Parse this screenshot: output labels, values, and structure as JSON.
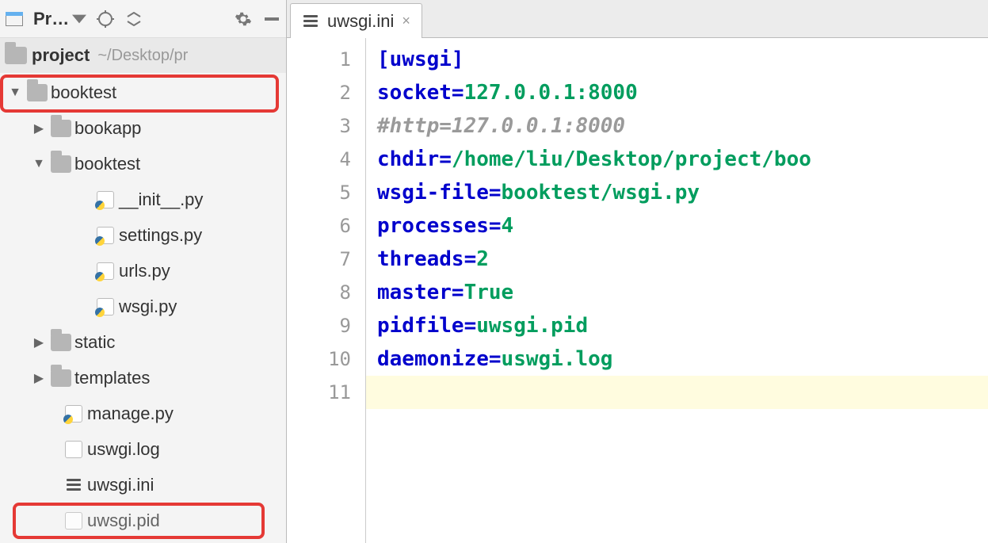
{
  "sidebar": {
    "toolbar_label": "Pr…",
    "root_name": "project",
    "root_path": "~/Desktop/pr",
    "tree": {
      "booktest": "booktest",
      "bookapp": "bookapp",
      "booktest_inner": "booktest",
      "init_py": "__init__.py",
      "settings_py": "settings.py",
      "urls_py": "urls.py",
      "wsgi_py": "wsgi.py",
      "static": "static",
      "templates": "templates",
      "manage_py": "manage.py",
      "uswgi_log": "uswgi.log",
      "uwsgi_ini": "uwsgi.ini",
      "uwsgi_pid": "uwsgi.pid"
    }
  },
  "tabs": {
    "active": "uwsgi.ini"
  },
  "gutter": [
    "1",
    "2",
    "3",
    "4",
    "5",
    "6",
    "7",
    "8",
    "9",
    "10",
    "11"
  ],
  "code": {
    "l1_section": "[uwsgi]",
    "l2_k": "socket",
    "l2_v": "127.0.0.1:8000",
    "l3_comment": "#http=127.0.0.1:8000",
    "l4_k": "chdir",
    "l4_v": "/home/liu/Desktop/project/boo",
    "l5_k": "wsgi-file",
    "l5_v": "booktest/wsgi.py",
    "l6_k": "processes",
    "l6_v": "4",
    "l7_k": "threads",
    "l7_v": "2",
    "l8_k": "master",
    "l8_v": "True",
    "l9_k": "pidfile",
    "l9_v": "uwsgi.pid",
    "l10_k": "daemonize",
    "l10_v": "uswgi.log"
  }
}
